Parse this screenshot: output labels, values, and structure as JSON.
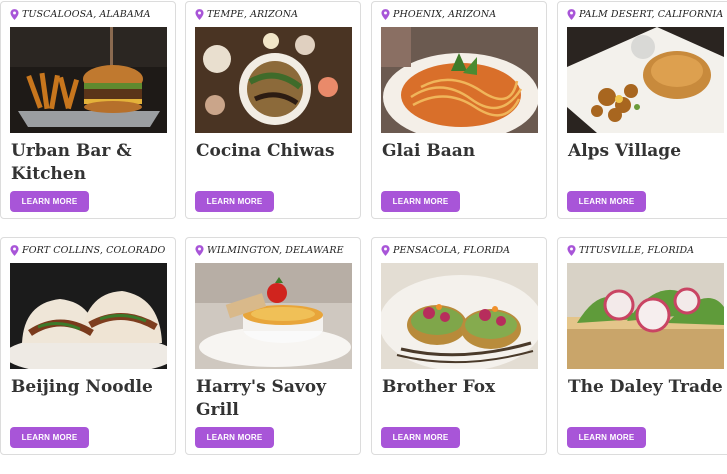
{
  "colors": {
    "accent": "#a855d8",
    "title": "#333333",
    "border": "#dcdcdc"
  },
  "button_label": "LEARN MORE",
  "cards": [
    {
      "location": "TUSCALOOSA, ALABAMA",
      "name": "Urban Bar & Kitchen",
      "photo": "burger-and-fries"
    },
    {
      "location": "TEMPE, ARIZONA",
      "name": "Cocina Chiwas",
      "photo": "mexican-plate"
    },
    {
      "location": "PHOENIX, ARIZONA",
      "name": "Glai Baan",
      "photo": "noodle-bowl"
    },
    {
      "location": "PALM DESERT, CALIFORNIA",
      "name": "Alps Village",
      "photo": "schnitzel-plate"
    },
    {
      "location": "FORT COLLINS, COLORADO",
      "name": "Beijing Noodle",
      "photo": "bao-buns"
    },
    {
      "location": "WILMINGTON, DELAWARE",
      "name": "Harry's Savoy Grill",
      "photo": "creme-brulee"
    },
    {
      "location": "PENSACOLA, FLORIDA",
      "name": "Brother Fox",
      "photo": "avocado-toast"
    },
    {
      "location": "TITUSVILLE, FLORIDA",
      "name": "The Daley Trade",
      "photo": "radish-toast"
    }
  ]
}
